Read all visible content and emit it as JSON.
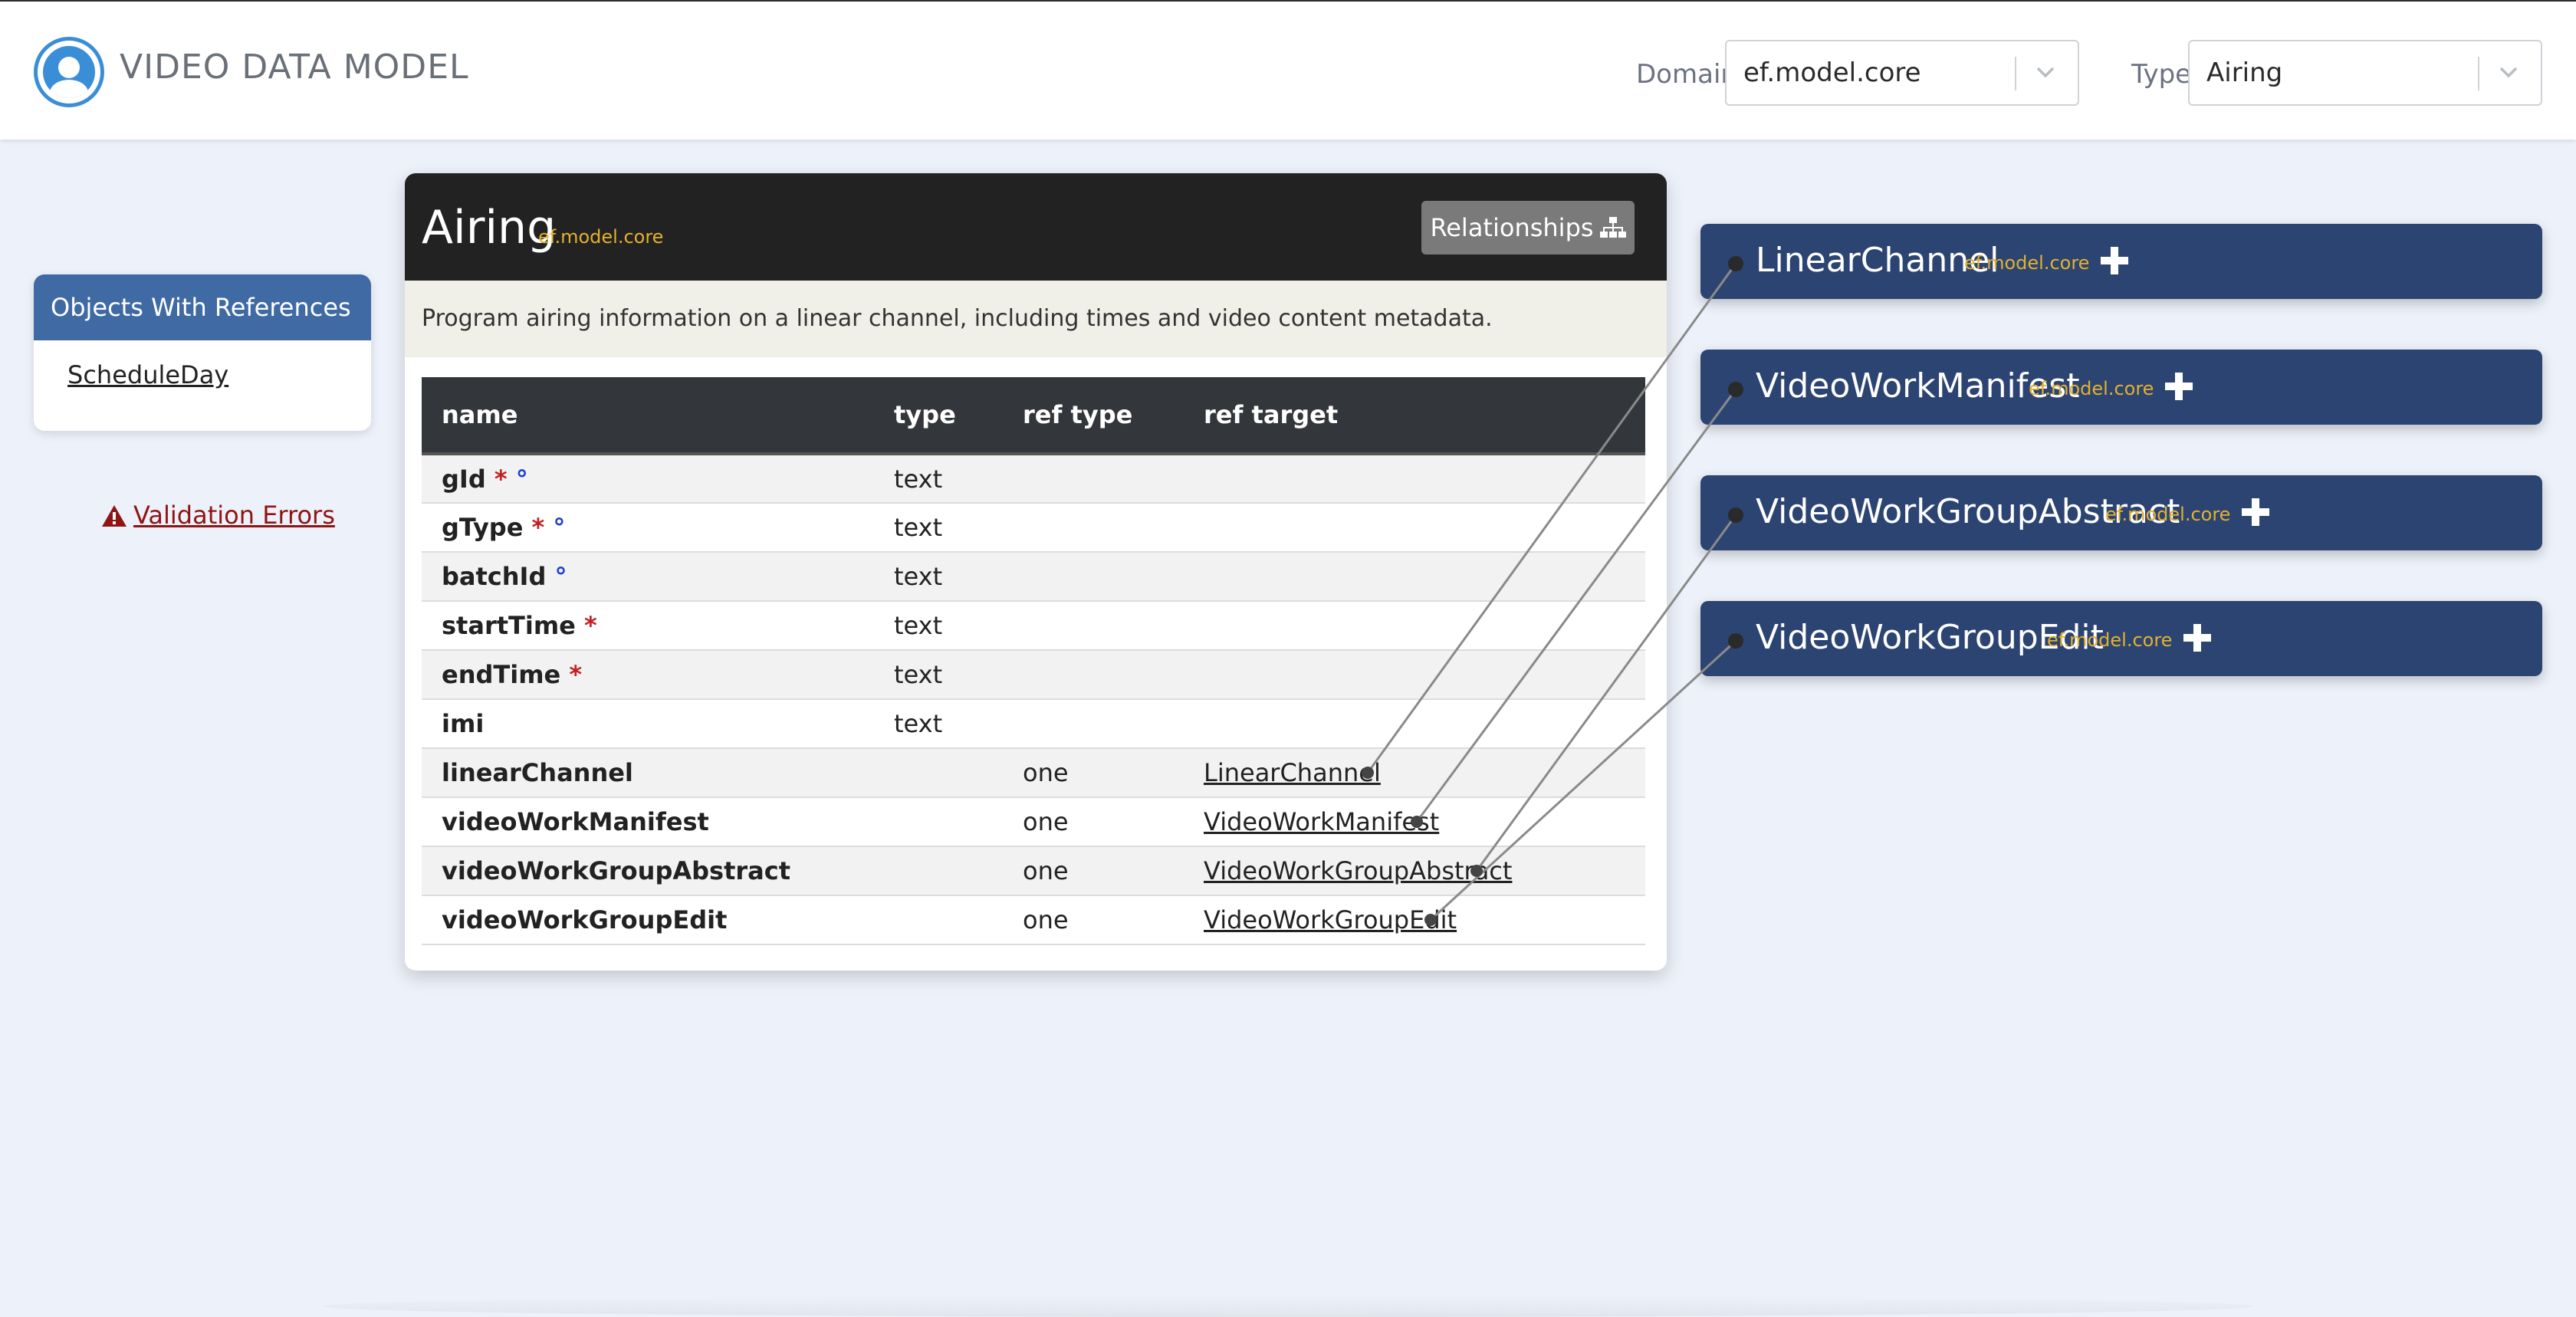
{
  "header": {
    "app_title": "VIDEO DATA MODEL",
    "domain_label": "Domain",
    "domain_value": "ef.model.core",
    "type_label": "Type",
    "type_value": "Airing"
  },
  "sidebar": {
    "references_title": "Objects With References",
    "references": [
      "ScheduleDay"
    ],
    "validation_errors_label": "Validation Errors"
  },
  "object": {
    "name": "Airing",
    "domain": "ef.model.core",
    "relationships_button": "Relationships",
    "description": "Program airing information on a linear channel, including times and video content metadata.",
    "columns": [
      "name",
      "type",
      "ref type",
      "ref target"
    ],
    "fields": [
      {
        "name": "gId",
        "required": "*",
        "identifier": "°",
        "type": "text",
        "ref_type": "",
        "ref_target": ""
      },
      {
        "name": "gType",
        "required": "*",
        "identifier": "°",
        "type": "text",
        "ref_type": "",
        "ref_target": ""
      },
      {
        "name": "batchId",
        "required": "",
        "identifier": "°",
        "type": "text",
        "ref_type": "",
        "ref_target": ""
      },
      {
        "name": "startTime",
        "required": "*",
        "identifier": "",
        "type": "text",
        "ref_type": "",
        "ref_target": ""
      },
      {
        "name": "endTime",
        "required": "*",
        "identifier": "",
        "type": "text",
        "ref_type": "",
        "ref_target": ""
      },
      {
        "name": "imi",
        "required": "",
        "identifier": "",
        "type": "text",
        "ref_type": "",
        "ref_target": ""
      },
      {
        "name": "linearChannel",
        "required": "",
        "identifier": "",
        "type": "",
        "ref_type": "one",
        "ref_target": "LinearChannel"
      },
      {
        "name": "videoWorkManifest",
        "required": "",
        "identifier": "",
        "type": "",
        "ref_type": "one",
        "ref_target": "VideoWorkManifest"
      },
      {
        "name": "videoWorkGroupAbstract",
        "required": "",
        "identifier": "",
        "type": "",
        "ref_type": "one",
        "ref_target": "VideoWorkGroupAbstract"
      },
      {
        "name": "videoWorkGroupEdit",
        "required": "",
        "identifier": "",
        "type": "",
        "ref_type": "one",
        "ref_target": "VideoWorkGroupEdit"
      }
    ]
  },
  "related": [
    {
      "name": "LinearChannel",
      "domain": "ef.model.core"
    },
    {
      "name": "VideoWorkManifest",
      "domain": "ef.model.core"
    },
    {
      "name": "VideoWorkGroupAbstract",
      "domain": "ef.model.core"
    },
    {
      "name": "VideoWorkGroupEdit",
      "domain": "ef.model.core"
    }
  ],
  "colors": {
    "header_bg": "#ffffff",
    "page_bg": "#edf1f9",
    "card_header": "#222222",
    "table_header": "#33363a",
    "related_box": "#2c4472",
    "sidebar_header": "#3f6aa3",
    "domain_text": "#e2b12f",
    "required_mark": "#c42020",
    "identifier_mark": "#1f3fd0",
    "error_text": "#8f1414"
  },
  "icons": {
    "logo": "logo-icon",
    "relationships": "sitemap-icon",
    "expand": "plus-icon",
    "warning": "warning-triangle-icon",
    "select_arrow": "chevron-down-icon"
  }
}
